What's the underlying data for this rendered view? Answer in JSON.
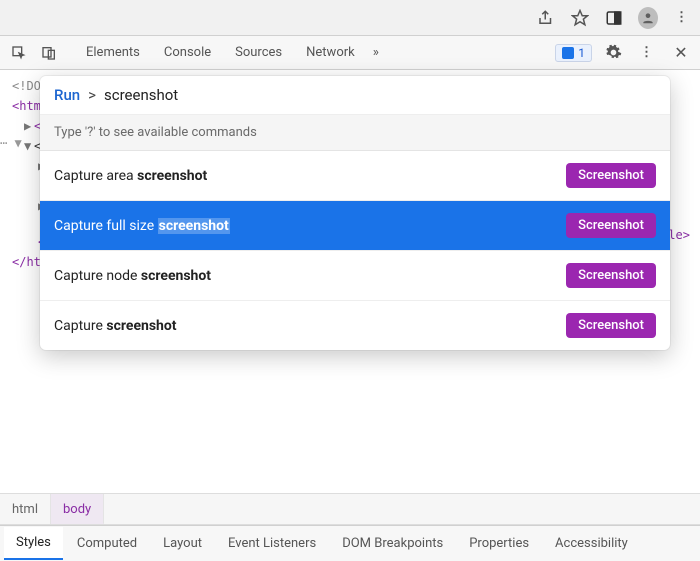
{
  "browser_icons": [
    "share",
    "star",
    "panel",
    "account",
    "menu"
  ],
  "devtools": {
    "tabs": [
      "Elements",
      "Console",
      "Sources",
      "Network"
    ],
    "overflow_glyph": "»",
    "issues_count": "1"
  },
  "dom": {
    "l0": "<!DO",
    "l1": "<htm",
    "l2": "<h",
    "l3": "<b",
    "l4_arrow": "▶",
    "l5_arrow": "▶",
    "l6": "<",
    "l7": "</ht",
    "le_frag": "le>"
  },
  "dots_glyph": "⋯ ▼",
  "cmd": {
    "run_label": "Run",
    "prompt_glyph": ">",
    "query_text": "screenshot",
    "hint": "Type '?' to see available commands",
    "badge": "Screenshot",
    "items": [
      {
        "pre": "Capture area ",
        "match": "screenshot",
        "post": "",
        "selected": false
      },
      {
        "pre": "Capture full size ",
        "match": "screenshot",
        "post": "",
        "selected": true
      },
      {
        "pre": "Capture node ",
        "match": "screenshot",
        "post": "",
        "selected": false
      },
      {
        "pre": "Capture ",
        "match": "screenshot",
        "post": "",
        "selected": false
      }
    ]
  },
  "crumbs": [
    "html",
    "body"
  ],
  "bottom_tabs": [
    "Styles",
    "Computed",
    "Layout",
    "Event Listeners",
    "DOM Breakpoints",
    "Properties",
    "Accessibility"
  ]
}
